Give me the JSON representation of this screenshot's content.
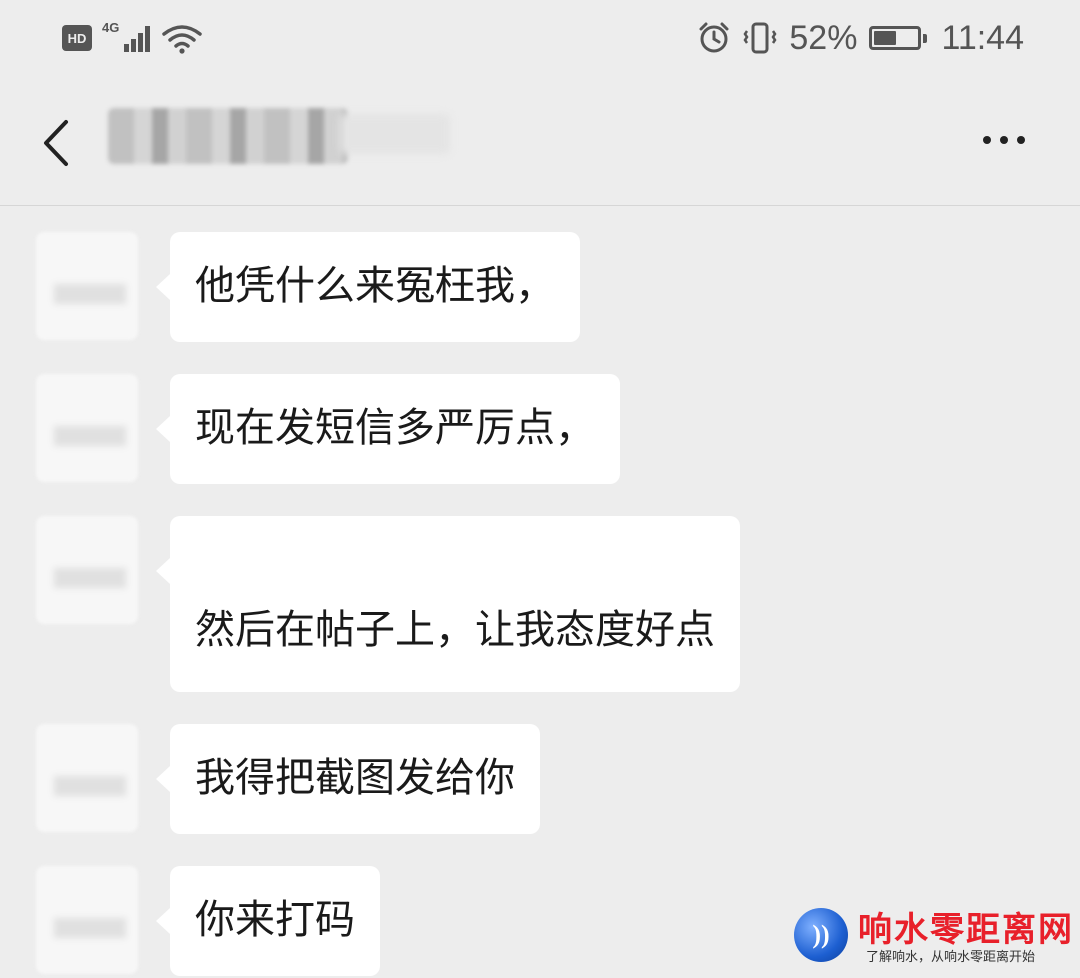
{
  "status_bar": {
    "hd": "HD",
    "network": "4G",
    "battery_percent": "52%",
    "battery_level": 0.52,
    "time": "11:44",
    "icons": [
      "signal-icon",
      "wifi-icon",
      "alarm-icon",
      "vibrate-icon",
      "battery-icon"
    ]
  },
  "header": {
    "title": "",
    "back_icon": "chevron-left-icon",
    "more_icon": "more-dots-icon"
  },
  "messages": [
    {
      "sender": "other",
      "text": "他凭什么来冤枉我，",
      "blank_first_line": false
    },
    {
      "sender": "other",
      "text": "现在发短信多严厉点，",
      "blank_first_line": false
    },
    {
      "sender": "other",
      "text": "然后在帖子上，让我态度好点",
      "blank_first_line": true
    },
    {
      "sender": "other",
      "text": "我得把截图发给你",
      "blank_first_line": false
    },
    {
      "sender": "other",
      "text": "你来打码",
      "blank_first_line": false
    }
  ],
  "watermark": {
    "title": "响水零距离网",
    "subtitle": "了解响水，从响水零距离开始"
  },
  "colors": {
    "background": "#ededed",
    "bubble": "#ffffff",
    "text": "#1a1a1a",
    "watermark_red": "#e8202a"
  }
}
